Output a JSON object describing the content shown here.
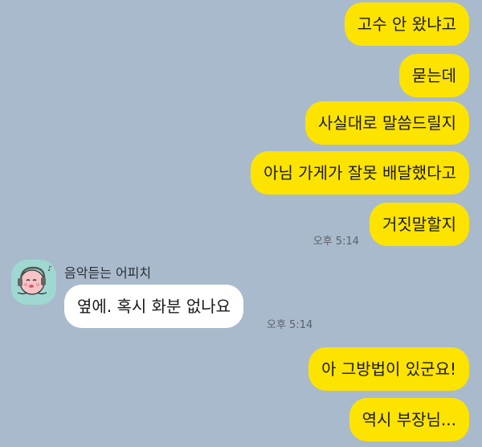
{
  "colors": {
    "background": "#a9bacd",
    "my_bubble": "#fde300",
    "other_bubble": "#ffffff",
    "avatar_bg": "#9fd8d0"
  },
  "messages_top": [
    {
      "text": "고수 안 왔냐고"
    },
    {
      "text": "묻는데"
    },
    {
      "text": "사실대로 말씀드릴지"
    },
    {
      "text": "아님 가게가 잘못 배달했다고"
    },
    {
      "text": "거짓말할지"
    }
  ],
  "time_top": "오후 5:14",
  "incoming": {
    "sender_name": "음악듣는 어피치",
    "avatar_icon": "apeach-headphones-avatar-icon",
    "text": "옆에.  혹시 화분 없나요",
    "time": "오후 5:14"
  },
  "messages_bottom": [
    {
      "text": "아 그방법이 있군요!"
    },
    {
      "text": "역시 부장님..."
    }
  ]
}
